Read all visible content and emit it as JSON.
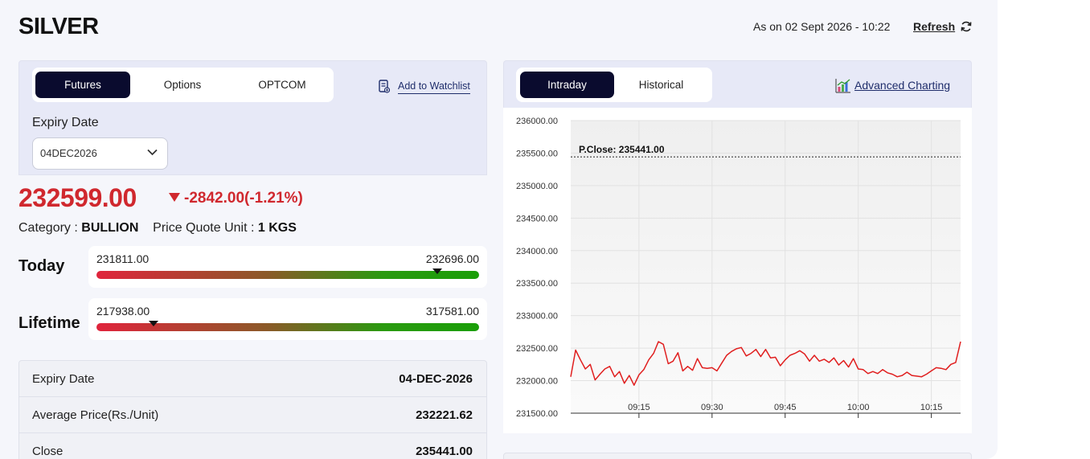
{
  "header": {
    "title": "SILVER",
    "as_on": "As on 02 Sept 2026 - 10:22",
    "refresh_label": "Refresh",
    "refresh_icon": "refresh-icon"
  },
  "left": {
    "tabs": [
      {
        "label": "Futures",
        "active": true
      },
      {
        "label": "Options",
        "active": false
      },
      {
        "label": "OPTCOM",
        "active": false
      }
    ],
    "watchlist_label": "Add to Watchlist",
    "watchlist_icon": "watchlist-icon",
    "expiry_label": "Expiry Date",
    "expiry_value": "04DEC2026",
    "price": "232599.00",
    "change": "-2842.00(-1.21%)",
    "category_label": "Category :",
    "category_value": "BULLION",
    "unit_label": "Price Quote Unit :",
    "unit_value": "1 KGS",
    "today": {
      "label": "Today",
      "low": "231811.00",
      "high": "232696.00",
      "marker_fraction": 0.89
    },
    "lifetime": {
      "label": "Lifetime",
      "low": "217938.00",
      "high": "317581.00",
      "marker_fraction": 0.15
    },
    "details": [
      {
        "key": "Expiry Date",
        "value": "04-DEC-2026"
      },
      {
        "key": "Average Price(Rs./Unit)",
        "value": "232221.62"
      },
      {
        "key": "Close",
        "value": "235441.00"
      }
    ]
  },
  "right": {
    "tabs": [
      {
        "label": "Intraday",
        "active": true
      },
      {
        "label": "Historical",
        "active": false
      }
    ],
    "advanced_label": "Advanced Charting",
    "advanced_icon": "chart-icon"
  },
  "chart_data": {
    "type": "line",
    "ylim": [
      231500,
      236000
    ],
    "yticks": [
      "236000.00",
      "235500.00",
      "235000.00",
      "234500.00",
      "234000.00",
      "233500.00",
      "233000.00",
      "232500.00",
      "232000.00",
      "231500.00"
    ],
    "ytick_values": [
      236000,
      235500,
      235000,
      234500,
      234000,
      233500,
      233000,
      232500,
      232000,
      231500
    ],
    "xticks": [
      "09:15",
      "09:30",
      "09:45",
      "10:00",
      "10:15"
    ],
    "xtick_minutes": [
      15,
      30,
      45,
      60,
      75
    ],
    "xlim_minutes": [
      1,
      81
    ],
    "reference_label": "P.Close: 235441.00",
    "reference_value": 235441,
    "line_color": "#e01e1e",
    "series": [
      {
        "x": [
          1,
          2,
          3,
          4,
          5,
          6,
          7,
          8,
          9,
          10,
          11,
          12,
          13,
          14,
          15,
          16,
          17,
          18,
          19,
          20,
          21,
          22,
          23,
          24,
          25,
          26,
          27,
          28,
          29,
          30,
          31,
          32,
          33,
          34,
          35,
          36,
          37,
          38,
          39,
          40,
          41,
          42,
          43,
          44,
          45,
          46,
          47,
          48,
          49,
          50,
          51,
          52,
          53,
          54,
          55,
          56,
          57,
          58,
          59,
          60,
          61,
          62,
          63,
          64,
          65,
          66,
          67,
          68,
          69,
          70,
          71,
          72,
          73,
          74,
          75,
          76,
          77,
          78,
          79,
          80,
          81
        ],
        "y": [
          232060,
          232470,
          232320,
          232180,
          232250,
          232010,
          232100,
          232180,
          232220,
          232060,
          232140,
          231960,
          232080,
          231930,
          232090,
          232170,
          232320,
          232420,
          232600,
          232560,
          232260,
          232300,
          232430,
          232150,
          232220,
          232160,
          232340,
          232200,
          232190,
          232200,
          232150,
          232270,
          232390,
          232450,
          232490,
          232510,
          232380,
          232420,
          232480,
          232370,
          232480,
          232350,
          232360,
          232230,
          232320,
          232390,
          232420,
          232460,
          232410,
          232300,
          232390,
          232300,
          232330,
          232280,
          232350,
          232240,
          232310,
          232210,
          232340,
          232180,
          232170,
          232110,
          232140,
          232110,
          232170,
          232120,
          232100,
          232060,
          232080,
          232130,
          232080,
          232070,
          232060,
          232100,
          232150,
          232200,
          232190,
          232170,
          232250,
          232280,
          232600
        ]
      }
    ]
  }
}
